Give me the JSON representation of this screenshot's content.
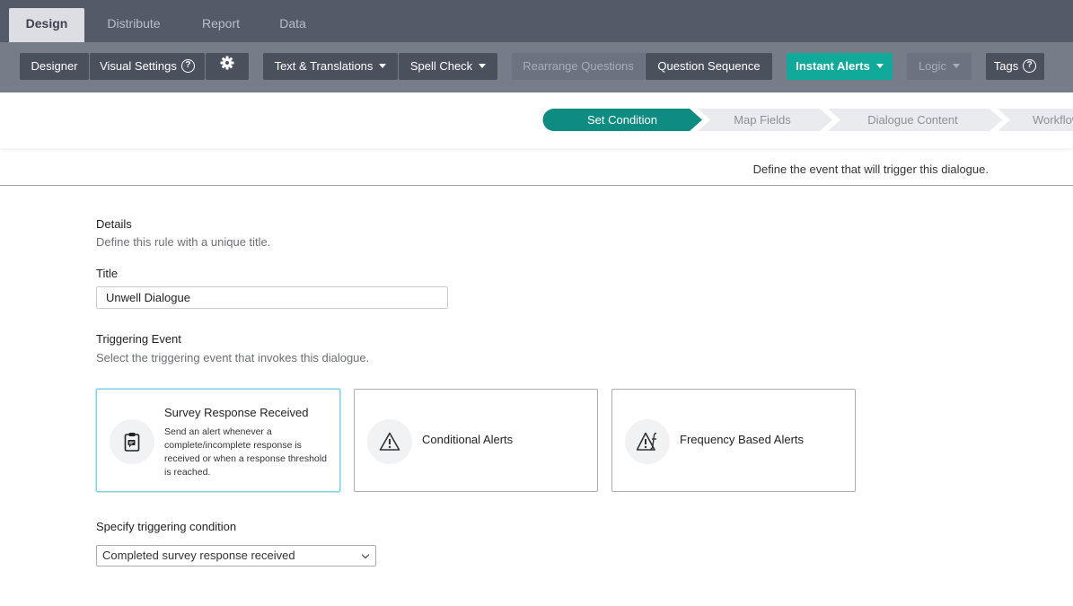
{
  "top_tabs": [
    {
      "label": "Design",
      "active": true
    },
    {
      "label": "Distribute"
    },
    {
      "label": "Report"
    },
    {
      "label": "Data"
    }
  ],
  "toolbar": {
    "designer": "Designer",
    "visual_settings": "Visual Settings",
    "text_translations": "Text & Translations",
    "spell_check": "Spell Check",
    "rearrange_questions": "Rearrange Questions",
    "question_sequence": "Question Sequence",
    "instant_alerts": "Instant Alerts",
    "logic": "Logic",
    "tags": "Tags",
    "help_glyph": "?"
  },
  "stepper": {
    "steps": [
      "Set Condition",
      "Map Fields",
      "Dialogue Content",
      "Workflow"
    ],
    "active_index": 0,
    "active_color": "#0e8c81",
    "inactive_color": "#e9ebee"
  },
  "trigger_note": "Define the event that will trigger this dialogue.",
  "details": {
    "heading": "Details",
    "subtext": "Define this rule with a unique title.",
    "title_label": "Title",
    "title_value": "Unwell Dialogue"
  },
  "triggering": {
    "heading": "Triggering Event",
    "subtext": "Select the triggering event that invokes this dialogue.",
    "cards": [
      {
        "title": "Survey Response Received",
        "desc": "Send an alert whenever a complete/incomplete response is received or when a response threshold is reached.",
        "icon": "clipboard-icon",
        "selected": true
      },
      {
        "title": "Conditional Alerts",
        "icon": "warning-icon",
        "selected": false
      },
      {
        "title": "Frequency Based Alerts",
        "icon": "warning-function-icon",
        "selected": false
      }
    ]
  },
  "condition": {
    "label": "Specify triggering condition",
    "selected": "Completed survey response received"
  }
}
